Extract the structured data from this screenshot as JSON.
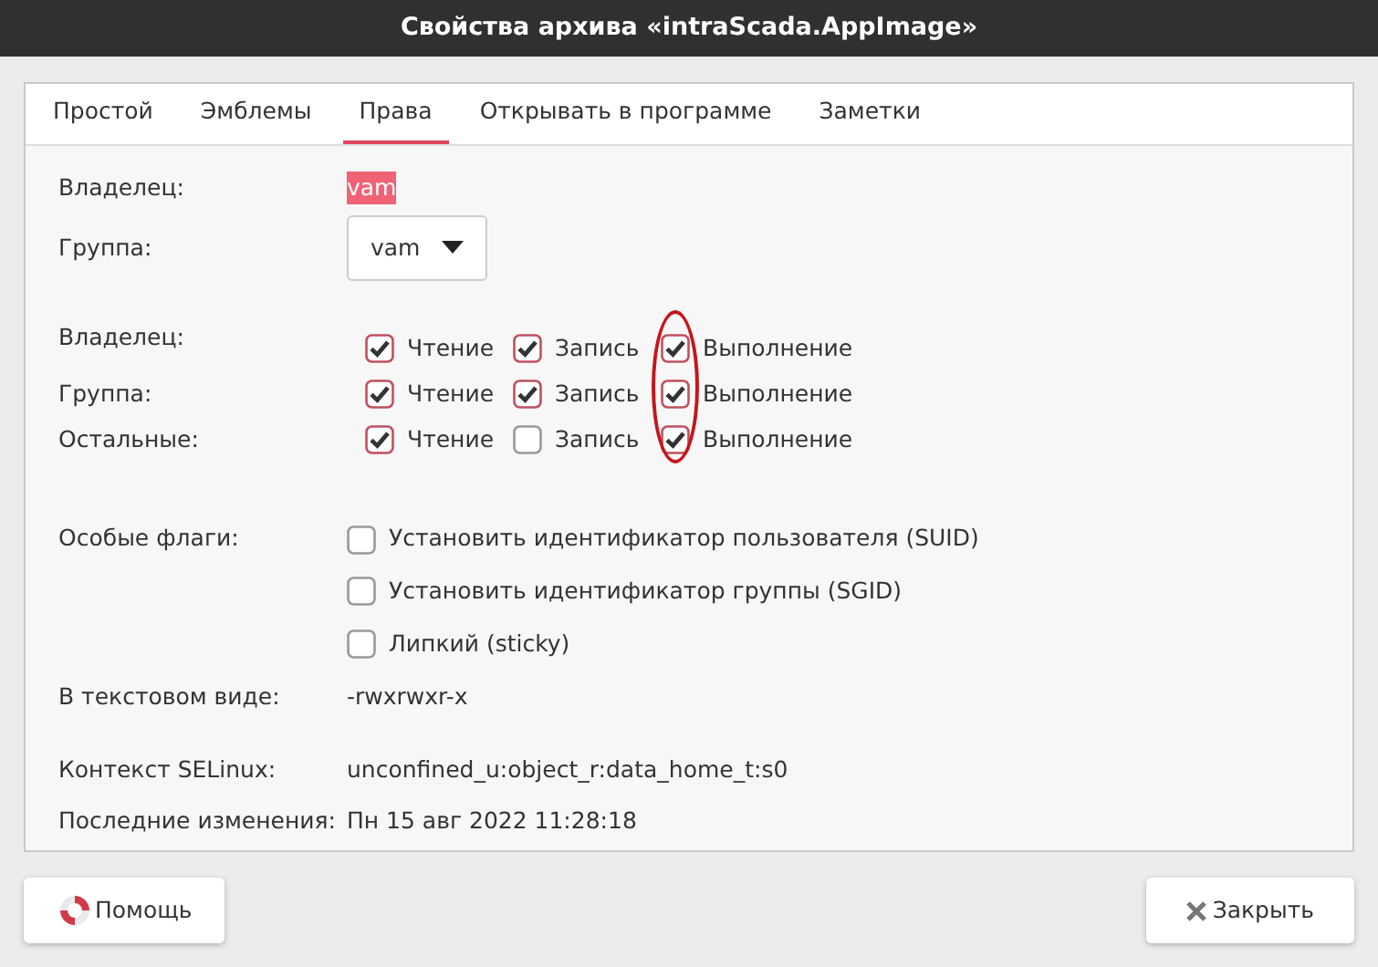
{
  "window": {
    "title": "Свойства архива «intraScada.AppImage»"
  },
  "tabs": [
    {
      "label": "Простой",
      "selected": false
    },
    {
      "label": "Эмблемы",
      "selected": false
    },
    {
      "label": "Права",
      "selected": true
    },
    {
      "label": "Открывать в программе",
      "selected": false
    },
    {
      "label": "Заметки",
      "selected": false
    }
  ],
  "owner": {
    "label": "Владелец:",
    "value": "vam",
    "selected": true
  },
  "group": {
    "label": "Группа:",
    "value": "vam"
  },
  "permissions": [
    {
      "label": "Владелец:",
      "checks": [
        {
          "label": "Чтение",
          "checked": true
        },
        {
          "label": "Запись",
          "checked": true
        },
        {
          "label": "Выполнение",
          "checked": true
        }
      ]
    },
    {
      "label": "Группа:",
      "checks": [
        {
          "label": "Чтение",
          "checked": true
        },
        {
          "label": "Запись",
          "checked": true
        },
        {
          "label": "Выполнение",
          "checked": true
        }
      ]
    },
    {
      "label": "Остальные:",
      "checks": [
        {
          "label": "Чтение",
          "checked": true
        },
        {
          "label": "Запись",
          "checked": false
        },
        {
          "label": "Выполнение",
          "checked": true
        }
      ]
    }
  ],
  "execute_column_circled": true,
  "special_flags": {
    "label": "Особые флаги:",
    "checks": [
      {
        "label": "Установить идентификатор пользователя (SUID)",
        "checked": false
      },
      {
        "label": "Установить идентификатор группы (SGID)",
        "checked": false
      },
      {
        "label": "Липкий (sticky)",
        "checked": false
      }
    ]
  },
  "text_view": {
    "label": "В текстовом виде:",
    "value": "-rwxrwxr-x"
  },
  "selinux": {
    "label": "Контекст SELinux:",
    "value": "unconfined_u:object_r:data_home_t:s0"
  },
  "modified": {
    "label": "Последние изменения:",
    "value": "Пн 15 авг 2022 11:28:18"
  },
  "buttons": [
    {
      "label": "Помощь",
      "kind": "help"
    },
    {
      "label": "Закрыть",
      "kind": "close"
    }
  ]
}
